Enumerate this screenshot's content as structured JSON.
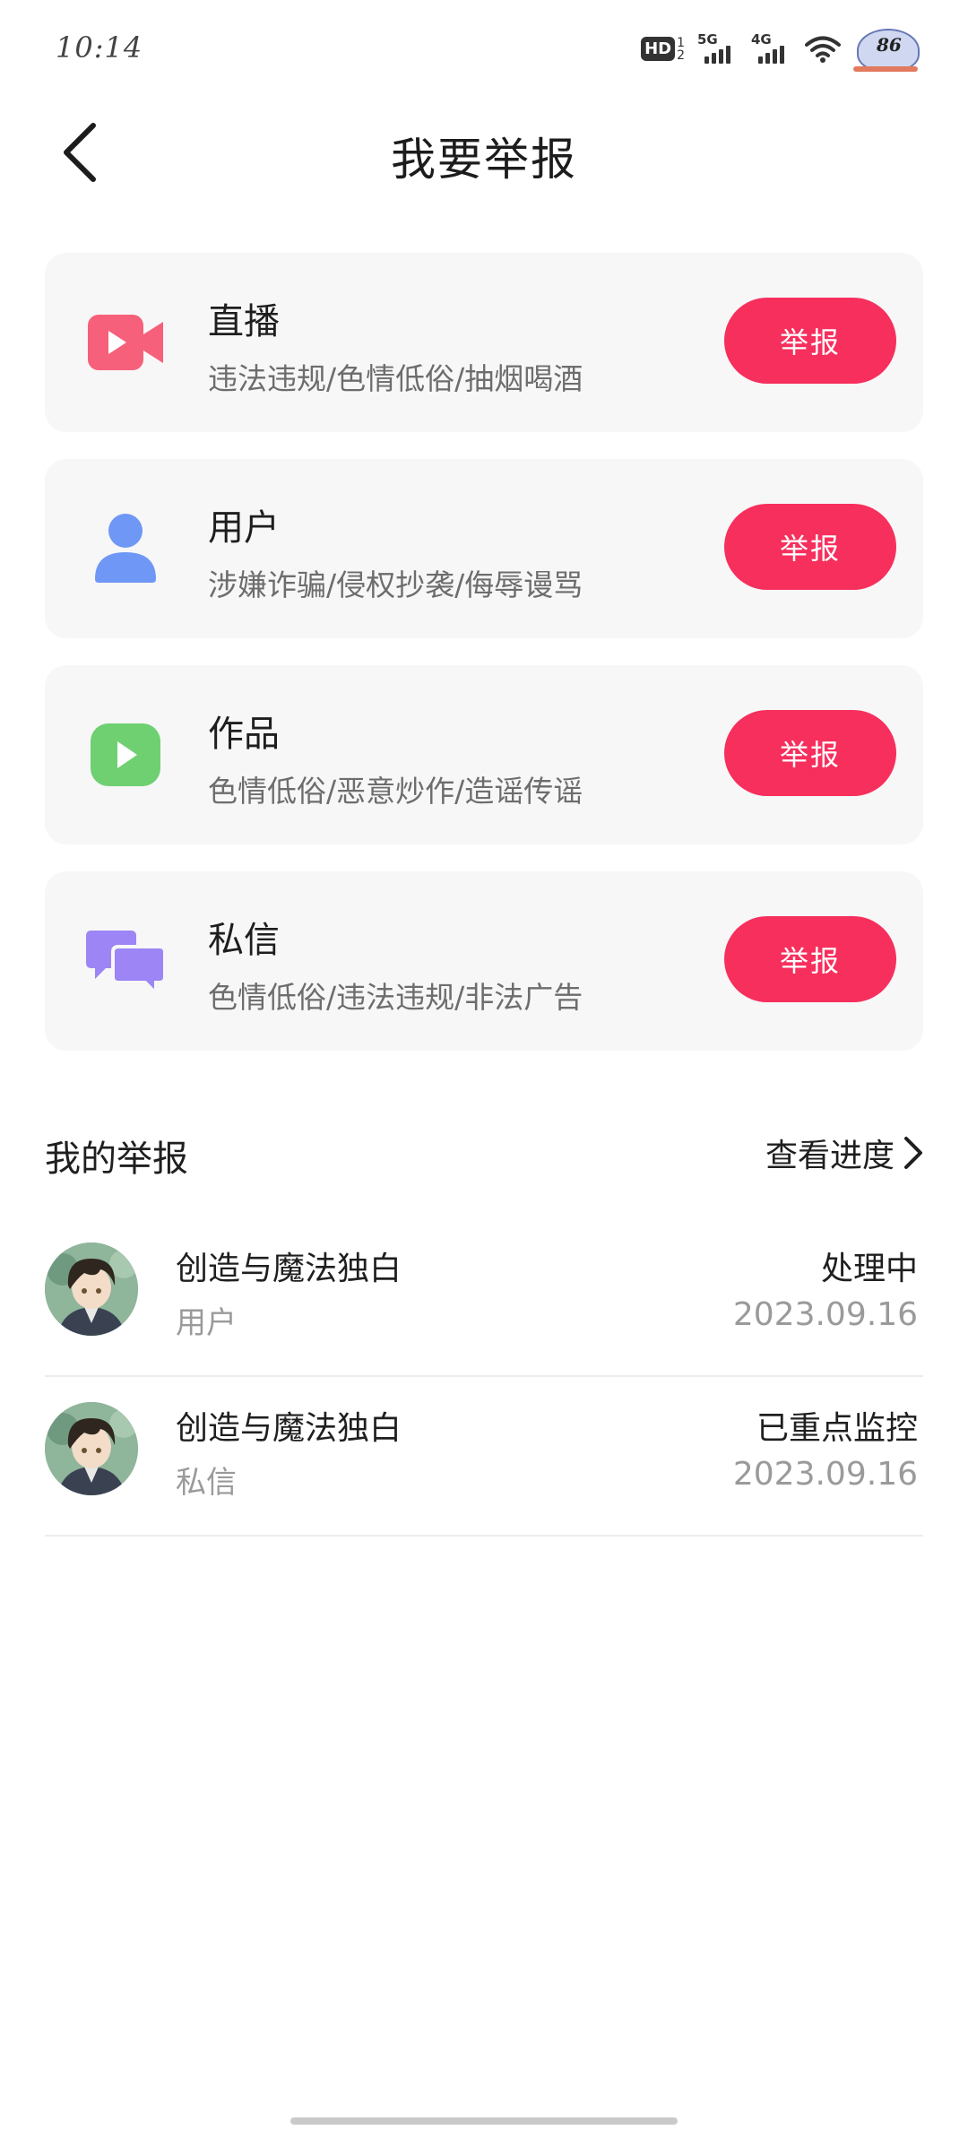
{
  "status_bar": {
    "time": "10:14",
    "hd_label": "HD",
    "hd_sup": "1",
    "hd_sub": "2",
    "signal1_label": "5G",
    "signal2_label": "4G",
    "battery_badge": "86"
  },
  "header": {
    "title": "我要举报",
    "back_icon": "chevron-left-icon"
  },
  "categories": [
    {
      "title": "直播",
      "subtitle": "违法违规/色情低俗/抽烟喝酒",
      "button": "举报",
      "icon": "video-camera-icon",
      "color": "#f7607a"
    },
    {
      "title": "用户",
      "subtitle": "涉嫌诈骗/侵权抄袭/侮辱谩骂",
      "button": "举报",
      "icon": "user-icon",
      "color": "#6f97f5"
    },
    {
      "title": "作品",
      "subtitle": "色情低俗/恶意炒作/造谣传谣",
      "button": "举报",
      "icon": "play-icon",
      "color": "#6fd072"
    },
    {
      "title": "私信",
      "subtitle": "色情低俗/违法违规/非法广告",
      "button": "举报",
      "icon": "chat-bubbles-icon",
      "color": "#9d85f5"
    }
  ],
  "my_reports": {
    "title": "我的举报",
    "view_progress": "查看进度",
    "items": [
      {
        "name": "创造与魔法独白",
        "type": "用户",
        "status": "处理中",
        "date": "2023.09.16"
      },
      {
        "name": "创造与魔法独白",
        "type": "私信",
        "status": "已重点监控",
        "date": "2023.09.16"
      }
    ]
  },
  "colors": {
    "accent": "#f72f5d",
    "card_bg": "#f7f7f7"
  }
}
